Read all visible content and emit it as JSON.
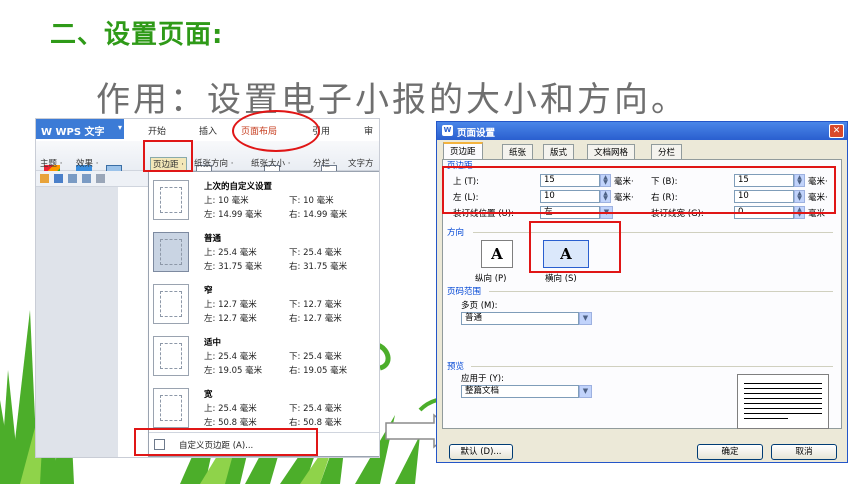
{
  "slide": {
    "title": "二、设置页面:",
    "subtitle": "作用：设置电子小报的大小和方向。"
  },
  "wps": {
    "app_name": "W WPS 文字",
    "tabs": [
      "开始",
      "插入",
      "页面布局",
      "引用",
      "审"
    ],
    "active_tab": "页面布局",
    "ribbon_labels": [
      "主题 ·",
      "效果 ·",
      "页边距 ·",
      "纸张方向 ·",
      "纸张大小 ·",
      "分栏 ·",
      "文字方"
    ],
    "margin_menu": {
      "items": [
        {
          "name": "上次的自定义设置",
          "top": "上: 10 毫米",
          "bottom": "下: 10 毫米",
          "left": "左: 14.99 毫米",
          "right": "右: 14.99 毫米"
        },
        {
          "name": "普通",
          "top": "上: 25.4 毫米",
          "bottom": "下: 25.4 毫米",
          "left": "左: 31.75 毫米",
          "right": "右: 31.75 毫米"
        },
        {
          "name": "窄",
          "top": "上: 12.7 毫米",
          "bottom": "下: 12.7 毫米",
          "left": "左: 12.7 毫米",
          "right": "右: 12.7 毫米"
        },
        {
          "name": "适中",
          "top": "上: 25.4 毫米",
          "bottom": "下: 25.4 毫米",
          "left": "左: 19.05 毫米",
          "right": "右: 19.05 毫米"
        },
        {
          "name": "宽",
          "top": "上: 25.4 毫米",
          "bottom": "下: 25.4 毫米",
          "left": "左: 50.8 毫米",
          "right": "右: 50.8 毫米"
        }
      ],
      "custom_label": "自定义页边距 (A)..."
    }
  },
  "dialog": {
    "title": "页面设置",
    "tabs": [
      "页边距",
      "纸张",
      "版式",
      "文档网格",
      "分栏"
    ],
    "margins_section": "页边距",
    "fields": {
      "top_label": "上 (T):",
      "top_value": "15",
      "bottom_label": "下 (B):",
      "bottom_value": "15",
      "left_label": "左 (L):",
      "left_value": "10",
      "right_label": "右 (R):",
      "right_value": "10",
      "gutter_pos_label": "装订线位置 (U):",
      "gutter_pos_value": "左",
      "gutter_width_label": "装订线宽 (G):",
      "gutter_width_value": "0",
      "unit": "毫米·"
    },
    "orientation_section": "方向",
    "portrait_label": "纵向 (P)",
    "landscape_label": "横向 (S)",
    "orientation_glyph": "A",
    "pages_section": "页码范围",
    "multiple_pages_label": "多页 (M):",
    "multiple_pages_value": "普通",
    "preview_section": "预览",
    "apply_to_label": "应用于 (Y):",
    "apply_to_value": "整篇文档",
    "default_button": "默认 (D)...",
    "ok_button": "确定",
    "cancel_button": "取消"
  },
  "colors": {
    "title_green": "#2f9a18",
    "highlight_red": "#e01616",
    "dialog_blue": "#2a5fcf"
  }
}
